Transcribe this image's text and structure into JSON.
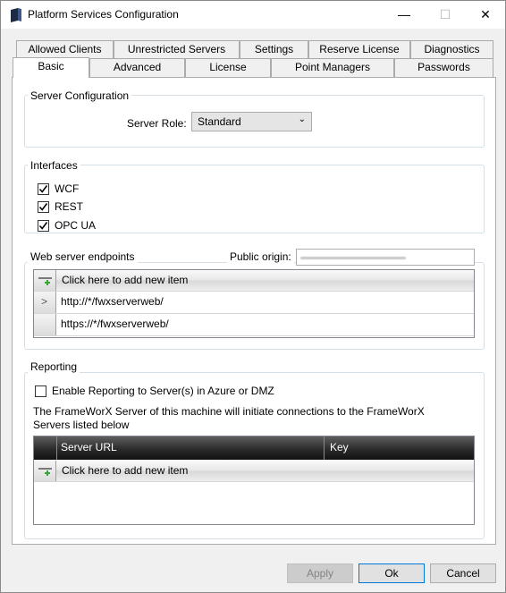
{
  "window": {
    "title": "Platform Services Configuration",
    "minimize": "—",
    "maximize": "☐",
    "close": "✕"
  },
  "tabs_row1": [
    "Allowed Clients",
    "Unrestricted Servers",
    "Settings",
    "Reserve License",
    "Diagnostics"
  ],
  "tabs_row2": [
    "Basic",
    "Advanced",
    "License",
    "Point Managers",
    "Passwords"
  ],
  "active_tab": "Basic",
  "server_config": {
    "legend": "Server Configuration",
    "role_label": "Server Role:",
    "role_value": "Standard"
  },
  "interfaces": {
    "legend": "Interfaces",
    "items": [
      {
        "label": "WCF",
        "checked": true
      },
      {
        "label": "REST",
        "checked": true
      },
      {
        "label": "OPC UA",
        "checked": true
      }
    ]
  },
  "endpoints": {
    "legend": "Web server endpoints",
    "origin_label": "Public origin:",
    "add_new": "Click here to add new item",
    "rows": [
      "http://*/fwxserverweb/",
      "https://*/fwxserverweb/"
    ],
    "current_row_glyph": ">"
  },
  "reporting": {
    "legend": "Reporting",
    "enable_label": "Enable Reporting to Server(s) in Azure or DMZ",
    "enable_checked": false,
    "description_line1": "The FrameWorX Server of this machine will initiate connections to the FrameWorX",
    "description_line2": "Servers listed below",
    "columns": [
      "Server URL",
      "Key"
    ],
    "add_new": "Click here to add new item"
  },
  "buttons": {
    "apply": "Apply",
    "ok": "Ok",
    "cancel": "Cancel"
  }
}
